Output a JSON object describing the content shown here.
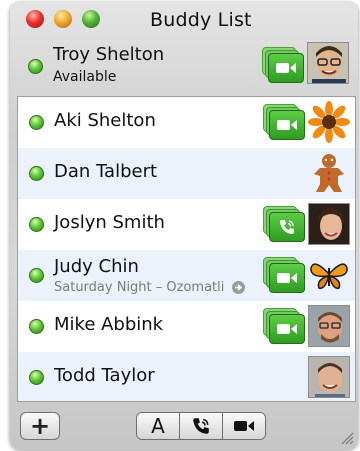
{
  "window": {
    "title": "Buddy List"
  },
  "me": {
    "name": "Troy Shelton",
    "status": "Available"
  },
  "buddies": [
    {
      "name": "Aki Shelton",
      "subtext": ""
    },
    {
      "name": "Dan Talbert",
      "subtext": ""
    },
    {
      "name": "Joslyn Smith",
      "subtext": ""
    },
    {
      "name": "Judy Chin",
      "subtext": "Saturday Night – Ozomatli"
    },
    {
      "name": "Mike Abbink",
      "subtext": ""
    },
    {
      "name": "Todd Taylor",
      "subtext": ""
    }
  ],
  "toolbar": {
    "add_label": "+",
    "text_chat_label": "A"
  },
  "colors": {
    "available": "#63c73a",
    "video_green": "#3cb02c",
    "alt_row": "#ecf2fb"
  },
  "icons": {
    "video": "video-camera-icon",
    "audio": "phone-audio-icon"
  }
}
